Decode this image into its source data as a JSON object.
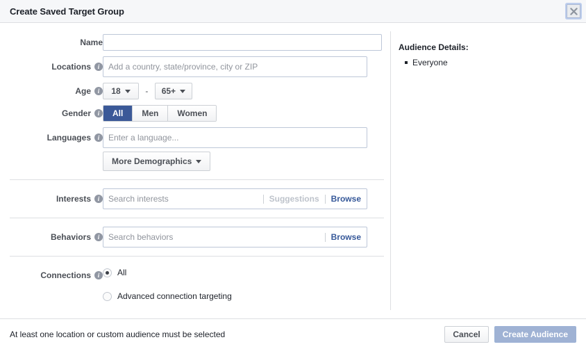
{
  "header": {
    "title": "Create Saved Target Group",
    "close_icon": "close-icon"
  },
  "form": {
    "name": {
      "label": "Name",
      "value": "",
      "placeholder": ""
    },
    "locations": {
      "label": "Locations",
      "value": "",
      "placeholder": "Add a country, state/province, city or ZIP",
      "info_icon": "info-icon"
    },
    "age": {
      "label": "Age",
      "min": "18",
      "max": "65+",
      "separator": "-",
      "info_icon": "info-icon"
    },
    "gender": {
      "label": "Gender",
      "options": [
        "All",
        "Men",
        "Women"
      ],
      "selected": "All",
      "info_icon": "info-icon"
    },
    "languages": {
      "label": "Languages",
      "value": "",
      "placeholder": "Enter a language...",
      "info_icon": "info-icon"
    },
    "more_demographics": {
      "label": "More Demographics"
    },
    "interests": {
      "label": "Interests",
      "value": "",
      "placeholder": "Search interests",
      "suggestions_label": "Suggestions",
      "browse_label": "Browse",
      "info_icon": "info-icon"
    },
    "behaviors": {
      "label": "Behaviors",
      "value": "",
      "placeholder": "Search behaviors",
      "browse_label": "Browse",
      "info_icon": "info-icon"
    },
    "connections": {
      "label": "Connections",
      "info_icon": "info-icon",
      "options": [
        {
          "label": "All",
          "selected": true
        },
        {
          "label": "Advanced connection targeting",
          "selected": false
        }
      ]
    }
  },
  "audience_details": {
    "title": "Audience Details:",
    "items": [
      "Everyone"
    ]
  },
  "footer": {
    "message": "At least one location or custom audience must be selected",
    "cancel_label": "Cancel",
    "create_label": "Create Audience"
  },
  "colors": {
    "accent_blue": "#3b5998",
    "primary_disabled": "#9fb2d4",
    "link_blue": "#365899",
    "border": "#dddfe2",
    "header_bg": "#f6f7f9"
  }
}
